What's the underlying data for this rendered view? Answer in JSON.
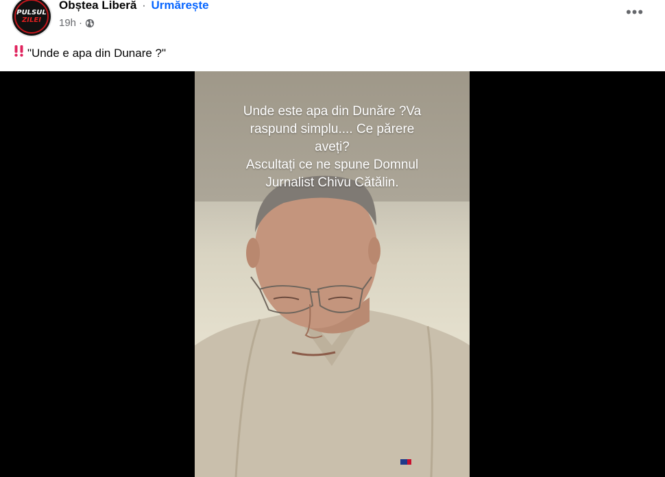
{
  "post": {
    "author": "Obștea Liberă",
    "separator": "·",
    "follow_label": "Urmărește",
    "time": "19h",
    "time_separator": "·",
    "text": "\"Unde e apa din Dunare ?\"",
    "more_label": "•••",
    "avatar": {
      "line1": "PULSUL",
      "line2": "ZILEI"
    }
  },
  "video": {
    "caption_lines": [
      "Unde este apa din Dunăre ?Va",
      "raspund simplu.... Ce părere",
      "aveți?",
      "Ascultați ce ne spune Domnul",
      "Jurnalist Chivu Cătălin."
    ]
  },
  "icons": {
    "privacy": "globe-icon",
    "emoji": "double-exclamation-icon",
    "menu": "more-horizontal-icon"
  },
  "colors": {
    "follow": "#0866ff",
    "meta": "#65676b",
    "emoji": "#e0245e"
  }
}
